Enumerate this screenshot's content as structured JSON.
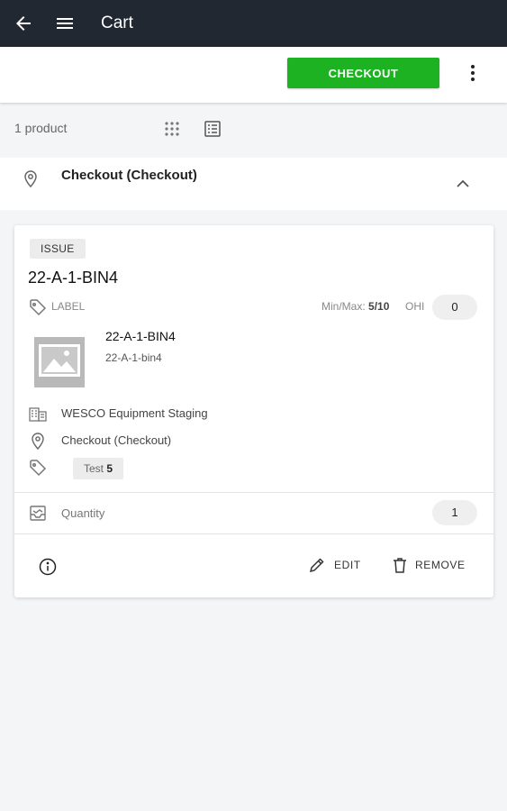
{
  "topbar": {
    "title": "Cart",
    "back_icon": "arrow-left-icon",
    "menu_icon": "hamburger-icon",
    "background": "#222831"
  },
  "actionbar": {
    "checkout_label": "CHECKOUT",
    "checkout_color": "#1db221",
    "more_icon": "kebab-icon"
  },
  "product_row": {
    "count_text": "1 product",
    "grid_view_icon": "grid-icon",
    "list_view_icon": "list-icon"
  },
  "location_group": {
    "title": "Checkout (Checkout)",
    "pin_icon": "location-pin-icon",
    "collapse_icon": "chevron-up-icon"
  },
  "card": {
    "badge": "ISSUE",
    "title": "22-A-1-BIN4",
    "label_text": "LABEL",
    "minmax_label": "Min/Max:",
    "minmax_value": "5/10",
    "ohi_label": "OHI",
    "ohi_value": "0",
    "item_name": "22-A-1-BIN4",
    "item_sub": "22-A-1-bin4",
    "site": "WESCO Equipment Staging",
    "location": "Checkout (Checkout)",
    "tag_name": "Test",
    "tag_count": "5",
    "quantity_label": "Quantity",
    "quantity_value": "1",
    "edit_label": "EDIT",
    "remove_label": "REMOVE"
  }
}
